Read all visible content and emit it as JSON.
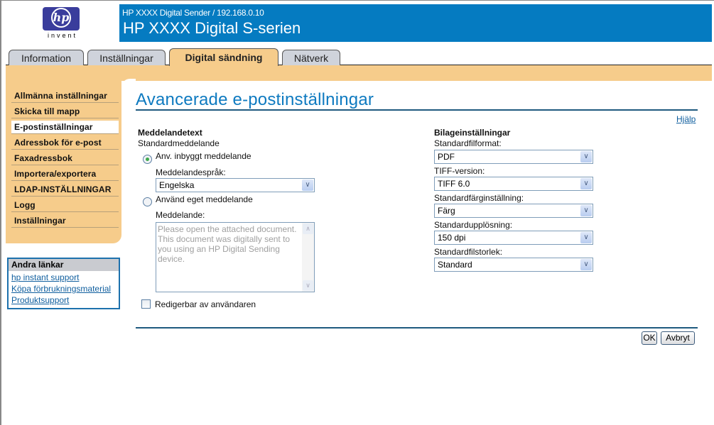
{
  "header": {
    "logo_text": "hp",
    "logo_tagline": "invent",
    "device_line": "HP XXXX Digital Sender / 192.168.0.10",
    "title": "HP XXXX Digital S-serien",
    "banner_color": "#057bc1"
  },
  "tabs": [
    {
      "label": "Information",
      "active": false
    },
    {
      "label": "Inställningar",
      "active": false
    },
    {
      "label": "Digital sändning",
      "active": true
    },
    {
      "label": "Nätverk",
      "active": false
    }
  ],
  "sidebar": {
    "items": [
      {
        "label": "Allmänna inställningar",
        "active": false
      },
      {
        "label": "Skicka till mapp",
        "active": false
      },
      {
        "label": "E-postinställningar",
        "active": true
      },
      {
        "label": "Adressbok för e-post",
        "active": false
      },
      {
        "label": "Faxadressbok",
        "active": false
      },
      {
        "label": "Importera/exportera",
        "active": false
      },
      {
        "label": "LDAP-INSTÄLLNINGAR",
        "active": false
      },
      {
        "label": "Logg",
        "active": false
      },
      {
        "label": "Inställningar",
        "active": false
      }
    ],
    "other_links": {
      "title": "Andra länkar",
      "links": [
        "hp instant support",
        "Köpa förbrukningsmaterial",
        "Produktsupport"
      ]
    }
  },
  "main": {
    "page_title": "Avancerade e-postinställningar",
    "help_link": "Hjälp",
    "message_section": {
      "heading": "Meddelandetext",
      "subheading": "Standardmeddelande",
      "radio_builtin": {
        "label": "Anv. inbyggt meddelande",
        "checked": true
      },
      "language_label": "Meddelandespråk:",
      "language_value": "Engelska",
      "radio_custom": {
        "label": "Använd eget meddelande",
        "checked": false
      },
      "message_label": "Meddelande:",
      "message_value": "Please open the attached document. This document was digitally sent to you using an HP Digital Sending device.",
      "editable_checkbox": {
        "label": "Redigerbar av användaren",
        "checked": false
      }
    },
    "attachment_section": {
      "heading": "Bilageinställningar",
      "fields": [
        {
          "label": "Standardfilformat:",
          "value": "PDF"
        },
        {
          "label": "TIFF-version:",
          "value": "TIFF 6.0"
        },
        {
          "label": "Standardfärginställning:",
          "value": "Färg"
        },
        {
          "label": "Standardupplösning:",
          "value": "150 dpi"
        },
        {
          "label": "Standardfilstorlek:",
          "value": "Standard"
        }
      ]
    },
    "buttons": {
      "ok": "OK",
      "cancel": "Avbryt"
    }
  }
}
